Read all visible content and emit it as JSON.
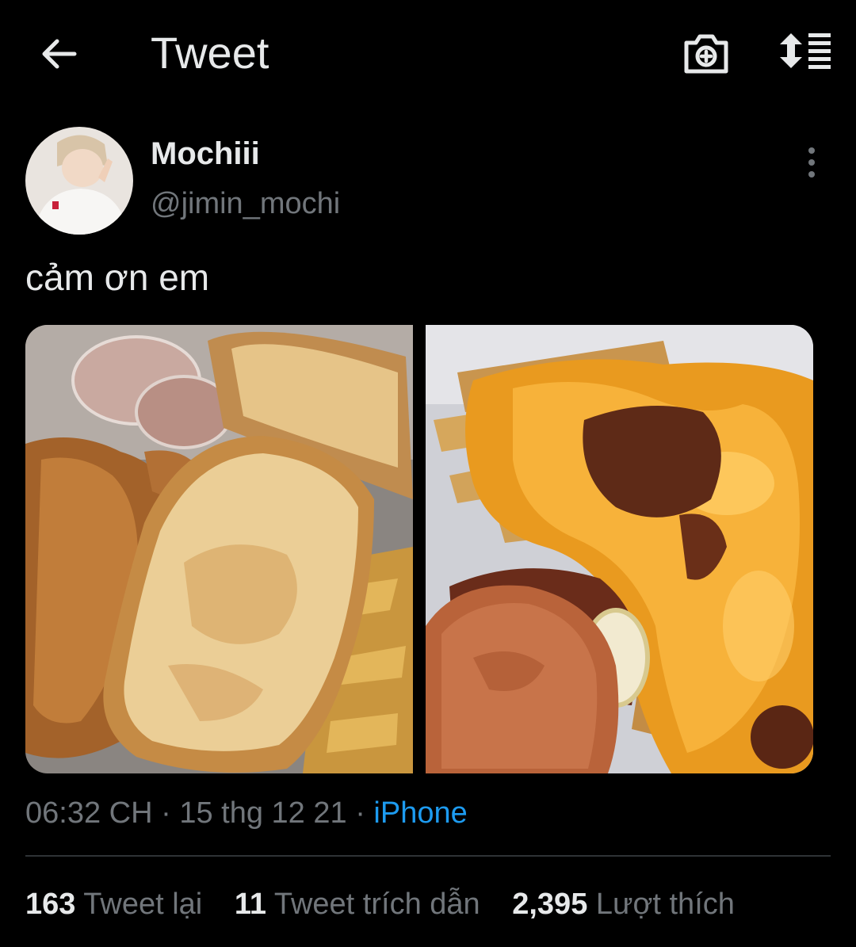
{
  "header": {
    "title": "Tweet",
    "back_icon": "arrow-left-icon",
    "camera_icon": "camera-plus-icon",
    "sort_icon": "sort-list-icon"
  },
  "author": {
    "name": "Mochiii",
    "handle": "@jimin_mochi",
    "more_icon": "more-vertical-icon"
  },
  "tweet": {
    "text": "cảm ơn em",
    "photos": [
      "food-photo-chicken-toast",
      "food-photo-burger-cheese-fries"
    ]
  },
  "meta": {
    "time": "06:32 CH",
    "sep1": " · ",
    "date": "15 thg 12 21",
    "sep2": " · ",
    "source": "iPhone"
  },
  "stats": [
    {
      "count": "163",
      "label": "Tweet lại"
    },
    {
      "count": "11",
      "label": "Tweet trích dẫn"
    },
    {
      "count": "2,395",
      "label": "Lượt thích"
    }
  ],
  "colors": {
    "background": "#000000",
    "text": "#e7e9ea",
    "secondary": "#71767b",
    "link": "#1d9bf0",
    "divider": "#2f3336"
  }
}
